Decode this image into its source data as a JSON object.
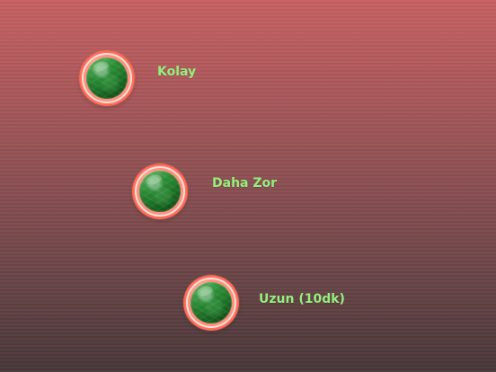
{
  "menu": {
    "items": [
      {
        "label": "Kolay",
        "icon": "green-orb-icon"
      },
      {
        "label": "Daha Zor",
        "icon": "green-orb-icon"
      },
      {
        "label": "Uzun (10dk)",
        "icon": "green-orb-icon"
      }
    ]
  },
  "colors": {
    "background_top": "#c65f61",
    "background_bottom": "#463638",
    "label": "#93f07c",
    "button_ring": "#ff5c43",
    "button_core": "#2b8d36"
  }
}
